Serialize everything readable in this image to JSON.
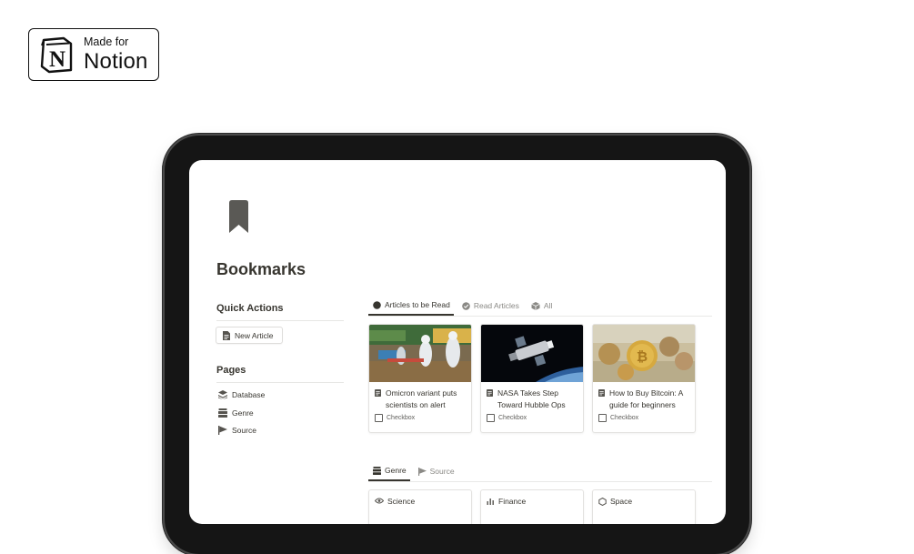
{
  "badge": {
    "made_for": "Made for",
    "brand": "Notion",
    "logo_letter": "N"
  },
  "page": {
    "icon": "bookmark-icon",
    "title": "Bookmarks"
  },
  "quick_actions": {
    "heading": "Quick Actions",
    "button": {
      "label": "New Article",
      "icon": "page-icon"
    }
  },
  "pages": {
    "heading": "Pages",
    "items": [
      {
        "label": "Database",
        "icon": "layers-icon"
      },
      {
        "label": "Genre",
        "icon": "books-icon"
      },
      {
        "label": "Source",
        "icon": "flag-icon"
      }
    ]
  },
  "article_tabs": [
    {
      "label": "Articles to be Read",
      "icon": "circle-icon",
      "active": true
    },
    {
      "label": "Read Articles",
      "icon": "check-circle-icon",
      "active": false
    },
    {
      "label": "All",
      "icon": "cube-icon",
      "active": false
    }
  ],
  "articles": [
    {
      "title": "Omicron variant puts scientists on alert",
      "checkbox_label": "Checkbox",
      "image": "medical-workers-photo"
    },
    {
      "title": "NASA Takes Step Toward Hubble Ops",
      "checkbox_label": "Checkbox",
      "image": "hubble-telescope-photo"
    },
    {
      "title": "How to Buy Bitcoin: A guide for beginners",
      "checkbox_label": "Checkbox",
      "image": "bitcoin-coins-photo"
    }
  ],
  "genre_tabs": [
    {
      "label": "Genre",
      "icon": "books-icon",
      "active": true
    },
    {
      "label": "Source",
      "icon": "flag-icon",
      "active": false
    }
  ],
  "genres": [
    {
      "label": "Science",
      "icon": "eye-icon"
    },
    {
      "label": "Finance",
      "icon": "bar-chart-icon"
    },
    {
      "label": "Space",
      "icon": "hexagon-icon"
    }
  ],
  "colors": {
    "text": "#37352f",
    "muted": "#8a8985",
    "device_frame": "#151515"
  }
}
